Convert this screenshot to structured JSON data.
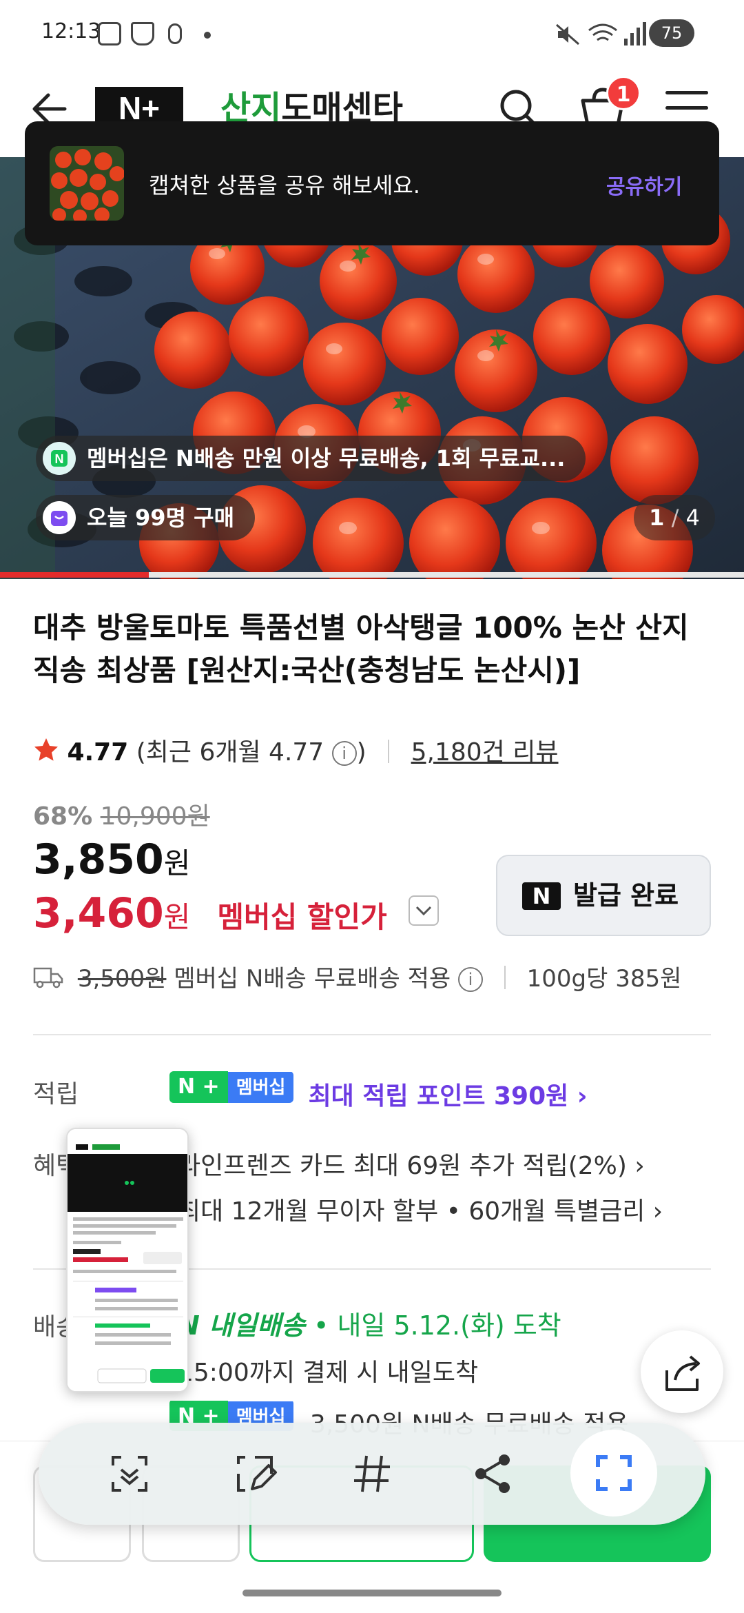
{
  "status_bar": {
    "time": "12:13",
    "battery": "75"
  },
  "header": {
    "store_name_green": "산지",
    "store_name_dark": "도매센타",
    "nplus_logo": "N+",
    "cart_count": "1"
  },
  "toast": {
    "message": "캡쳐한 상품을 공유 해보세요.",
    "action": "공유하기"
  },
  "hero": {
    "membership_pill": "멤버십은 N배송 만원 이상 무료배송, 1회 무료교...",
    "buyers_pill": "오늘 99명 구매",
    "page_current": "1",
    "page_total": "4",
    "image_progress_fraction": 0.2
  },
  "product": {
    "title": "대추 방울토마토 특품선별 아삭탱글 100% 논산 산지직송 최상품 [원산지:국산(충청남도 논산시)]",
    "rating": "4.77",
    "rating_recent": "(최근 6개월 4.77",
    "rating_recent_close": ")",
    "review_count": "5,180건 리뷰",
    "discount_rate": "68%",
    "original_price": "10,900원",
    "price": "3,850",
    "price_unit": "원",
    "member_price": "3,460",
    "member_price_unit": "원",
    "member_price_label": "멤버십 할인가",
    "coupon_button": "발급 완료",
    "shipping_struck": "3,500원",
    "shipping_text": "멤버십 N배송 무료배송 적용",
    "unit_price": "100g당 385원"
  },
  "points": {
    "label": "적립",
    "badge_n": "N +",
    "badge_membership": "멤버십",
    "text": "최대 적립 포인트 390원 ›"
  },
  "benefits": {
    "label": "혜택",
    "line1": "라인프렌즈 카드 최대 69원 추가 적립(2%) ›",
    "line2": "최대 12개월 무이자 할부 • 60개월 특별금리 ›"
  },
  "delivery": {
    "label": "배송",
    "brand": "N 내일배송",
    "date": " • 내일 5.12.(화) 도착",
    "note": "15:00까지 결제 시 내일도착",
    "line3": "3,500원 N배송 무료배송 적용"
  },
  "colors": {
    "accent_green": "#15c45a",
    "accent_red": "#d6213a",
    "accent_purple": "#6c3be3"
  }
}
